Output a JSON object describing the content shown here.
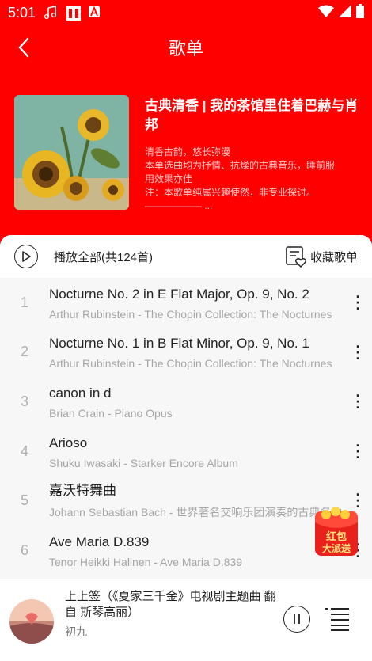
{
  "status_bar": {
    "time": "5:01"
  },
  "nav": {
    "title": "歌单"
  },
  "playlist": {
    "title": "古典清香 | 我的茶馆里住着巴赫与肖邦",
    "desc_lines": [
      "清香古韵，悠长弥漫",
      "本单选曲均为抒情、抗燥的古典音乐，睡前服",
      "用效果亦佳",
      "注：本歌单纯属兴趣使然，非专业探讨。",
      "—————— ..."
    ]
  },
  "actions": {
    "play_all": "播放全部(共124首)",
    "collect": "收藏歌单"
  },
  "songs": [
    {
      "num": "1",
      "title": "Nocturne No. 2 in E Flat Major, Op. 9, No. 2",
      "subtitle": "Arthur Rubinstein - The Chopin Collection: The Nocturnes"
    },
    {
      "num": "2",
      "title": "Nocturne No. 1 in B Flat Minor, Op. 9, No. 1",
      "subtitle": "Arthur Rubinstein - The Chopin Collection: The Nocturnes"
    },
    {
      "num": "3",
      "title": "canon in d",
      "subtitle": "Brian Crain - Piano Opus"
    },
    {
      "num": "4",
      "title": "Arioso",
      "subtitle": "Shuku Iwasaki - Starker Encore Album"
    },
    {
      "num": "5",
      "title": "嘉沃特舞曲",
      "subtitle": "Johann Sebastian Bach - 世界著名交响乐团演奏的古典名曲"
    },
    {
      "num": "6",
      "title": "Ave Maria D.839",
      "subtitle": "Tenor Heikki Halinen - Ave Maria D.839"
    }
  ],
  "red_packet": {
    "line1": "红包",
    "line2": "大派送"
  },
  "player": {
    "title": "上上签（《夏家三千金》电视剧主题曲 翻自 斯琴高丽）",
    "artist": "初九"
  },
  "colors": {
    "brand_red": "#ff0000",
    "text_primary": "#222222",
    "text_secondary": "#a6a6a6"
  }
}
